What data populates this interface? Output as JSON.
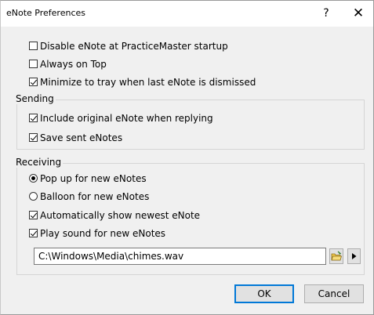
{
  "window": {
    "title": "eNote Preferences",
    "help_glyph": "?",
    "close_glyph": "✕"
  },
  "general": [
    {
      "label": "Disable eNote at PracticeMaster startup",
      "checked": false
    },
    {
      "label": "Always on Top",
      "checked": false
    },
    {
      "label": "Minimize to tray when last eNote is dismissed",
      "checked": true
    }
  ],
  "sending": {
    "title": "Sending",
    "options": [
      {
        "label": "Include original eNote when replying",
        "checked": true
      },
      {
        "label": "Save sent eNotes",
        "checked": true
      }
    ]
  },
  "receiving": {
    "title": "Receiving",
    "radios": [
      {
        "label": "Pop up for new eNotes",
        "selected": true
      },
      {
        "label": "Balloon for new eNotes",
        "selected": false
      }
    ],
    "options": [
      {
        "label": "Automatically show newest eNote",
        "checked": true
      },
      {
        "label": "Play sound for new eNotes",
        "checked": true
      }
    ],
    "sound_path": "C:\\Windows\\Media\\chimes.wav",
    "browse_icon": "folder-icon",
    "play_icon": "play-icon"
  },
  "buttons": {
    "ok": "OK",
    "cancel": "Cancel"
  },
  "colors": {
    "accent": "#0078d7",
    "dialog_bg": "#f0f0f0"
  }
}
